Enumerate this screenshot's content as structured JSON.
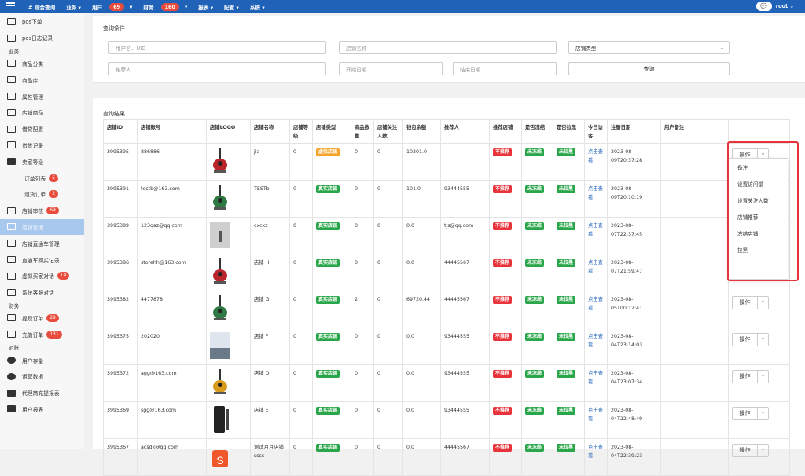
{
  "topbar": {
    "menu": [
      {
        "label": "# 综合查询"
      },
      {
        "label": "业务 ▾"
      },
      {
        "label": "用户",
        "badge": "69",
        "caret": "▾"
      },
      {
        "label": "财务",
        "badge": "160",
        "caret": "▾"
      },
      {
        "label": "报表 ▾"
      },
      {
        "label": "配置 ▾"
      },
      {
        "label": "系统 ▾"
      }
    ],
    "user": "root ⌄"
  },
  "sidebar": [
    {
      "label": "pos下单",
      "icon": "box"
    },
    {
      "label": "pos日志记录",
      "icon": "box"
    },
    {
      "label": "业务",
      "section": true
    },
    {
      "label": "商品分类",
      "icon": "laptop"
    },
    {
      "label": "商品库",
      "icon": "box"
    },
    {
      "label": "属性管理",
      "icon": "box"
    },
    {
      "label": "店铺商品",
      "icon": "box"
    },
    {
      "label": "借贷配置",
      "icon": "box"
    },
    {
      "label": "借贷记录",
      "icon": "box"
    },
    {
      "label": "卖家等级",
      "icon": "list"
    },
    {
      "label": "订单列表",
      "sub": true,
      "badge": "5"
    },
    {
      "label": "退货订单",
      "sub": true,
      "badge": "2"
    },
    {
      "label": "店铺审核",
      "icon": "card",
      "badge": "69"
    },
    {
      "label": "店铺管理",
      "icon": "card",
      "active": true
    },
    {
      "label": "店铺直通车管理",
      "icon": "card"
    },
    {
      "label": "直通车购买记录",
      "icon": "card"
    },
    {
      "label": "虚拟买家对话",
      "icon": "card",
      "badge": "14"
    },
    {
      "label": "系统客服对话",
      "icon": "card"
    },
    {
      "label": "财务",
      "section": true
    },
    {
      "label": "提现订单",
      "icon": "card",
      "badge": "29"
    },
    {
      "label": "充值订单",
      "icon": "card",
      "badge": "131"
    },
    {
      "label": "对账",
      "section": true
    },
    {
      "label": "用户存量",
      "icon": "pie"
    },
    {
      "label": "运营数据",
      "icon": "pie"
    },
    {
      "label": "代理商充提报表",
      "icon": "tree"
    },
    {
      "label": "用户报表",
      "icon": "lines"
    }
  ],
  "query": {
    "title": "查询条件",
    "user_ph": "用户名、UID",
    "shop_ph": "店铺名称",
    "type_label": "店铺类型",
    "ref_ph": "推荐人",
    "start_ph": "开始日期",
    "end_ph": "结束日期",
    "search_btn": "查询"
  },
  "results": {
    "title": "查询结果",
    "headers": [
      "店铺ID",
      "店铺账号",
      "店铺LOGO",
      "店铺名称",
      "店铺等级",
      "店铺类型",
      "商品数量",
      "店铺关注人数",
      "钱包余额",
      "推荐人",
      "推荐店铺",
      "是否冻结",
      "是否拉黑",
      "今日访客",
      "注册日期",
      "用户备注",
      ""
    ],
    "rows": [
      {
        "id": "3995395",
        "account": "886886",
        "logo": "guitar-red",
        "name": "jia",
        "level": "0",
        "type": "虚拟店铺",
        "type_color": "orange",
        "goods": "0",
        "fans": "0",
        "balance": "10201.0",
        "ref": "",
        "rec": "不推荐",
        "frozen": "未冻结",
        "black": "未拉黑",
        "visit": "点击查看",
        "date": "2023-08-09T20:37:28",
        "note": ""
      },
      {
        "id": "3995391",
        "account": "testb@163.com",
        "logo": "guitar-green",
        "name": "TESTb",
        "level": "0",
        "type": "真实店铺",
        "type_color": "green",
        "goods": "0",
        "fans": "0",
        "balance": "101.0",
        "ref": "93444555",
        "rec": "不推荐",
        "frozen": "未冻结",
        "black": "未拉黑",
        "visit": "点击查看",
        "date": "2023-08-09T20:10:19",
        "note": ""
      },
      {
        "id": "3995389",
        "account": "123qaz@qq.com",
        "logo": "photo-gray",
        "name": "cxcxz",
        "level": "0",
        "type": "真实店铺",
        "type_color": "green",
        "goods": "0",
        "fans": "0",
        "balance": "0.0",
        "ref": "tjs@qq.com",
        "rec": "不推荐",
        "frozen": "未冻结",
        "black": "未拉黑",
        "visit": "点击查看",
        "date": "2023-08-07T22:37:45",
        "note": ""
      },
      {
        "id": "3995386",
        "account": "storehh@163.com",
        "logo": "guitar-red",
        "name": "店铺 H",
        "level": "0",
        "type": "真实店铺",
        "type_color": "green",
        "goods": "0",
        "fans": "0",
        "balance": "0.0",
        "ref": "44445567",
        "rec": "不推荐",
        "frozen": "未冻结",
        "black": "未拉黑",
        "visit": "点击查看",
        "date": "2023-08-07T21:59:47",
        "note": ""
      },
      {
        "id": "3995382",
        "account": "4477878",
        "logo": "guitar-green",
        "name": "店铺 G",
        "level": "0",
        "type": "真实店铺",
        "type_color": "green",
        "goods": "2",
        "fans": "0",
        "balance": "69720.44",
        "ref": "44445567",
        "rec": "不推荐",
        "frozen": "未冻结",
        "black": "未拉黑",
        "visit": "点击查看",
        "date": "2023-08-05T00:12:41",
        "note": ""
      },
      {
        "id": "3995375",
        "account": "202020",
        "logo": "photo-sky",
        "name": "店铺 F",
        "level": "0",
        "type": "真实店铺",
        "type_color": "green",
        "goods": "0",
        "fans": "0",
        "balance": "0.0",
        "ref": "93444555",
        "rec": "不推荐",
        "frozen": "未冻结",
        "black": "未拉黑",
        "visit": "点击查看",
        "date": "2023-08-04T23:14:03",
        "note": ""
      },
      {
        "id": "3995372",
        "account": "agg@163.com",
        "logo": "guitar-yellow",
        "name": "店铺 D",
        "level": "0",
        "type": "真实店铺",
        "type_color": "green",
        "goods": "0",
        "fans": "0",
        "balance": "0.0",
        "ref": "93444555",
        "rec": "不推荐",
        "frozen": "未冻结",
        "black": "未拉黑",
        "visit": "点击查看",
        "date": "2023-08-04T23:07:34",
        "note": ""
      },
      {
        "id": "3995369",
        "account": "sgg@163.com",
        "logo": "phone-dark",
        "name": "店铺 E",
        "level": "0",
        "type": "真实店铺",
        "type_color": "green",
        "goods": "0",
        "fans": "0",
        "balance": "0.0",
        "ref": "93444555",
        "rec": "不推荐",
        "frozen": "未冻结",
        "black": "未拉黑",
        "visit": "点击查看",
        "date": "2023-08-04T22:48:49",
        "note": ""
      },
      {
        "id": "3995367",
        "account": "acsdk@qq.com",
        "logo": "shopee",
        "name": "测试月月店铺ssss",
        "level": "0",
        "type": "真实店铺",
        "type_color": "green",
        "goods": "0",
        "fans": "0",
        "balance": "0.0",
        "ref": "44445567",
        "rec": "不推荐",
        "frozen": "未冻结",
        "black": "未拉黑",
        "visit": "点击查看",
        "date": "2023-08-04T22:39:23",
        "note": ""
      }
    ],
    "op_label": "操作",
    "dropdown": [
      "备注",
      "设置访问量",
      "设置关注人数",
      "店铺推荐",
      "冻结店铺",
      "拉黑"
    ]
  },
  "colors": {
    "topbar": "#1f62b8",
    "red": "#e8333a",
    "green": "#2aa64a",
    "orange": "#f7a42a"
  }
}
